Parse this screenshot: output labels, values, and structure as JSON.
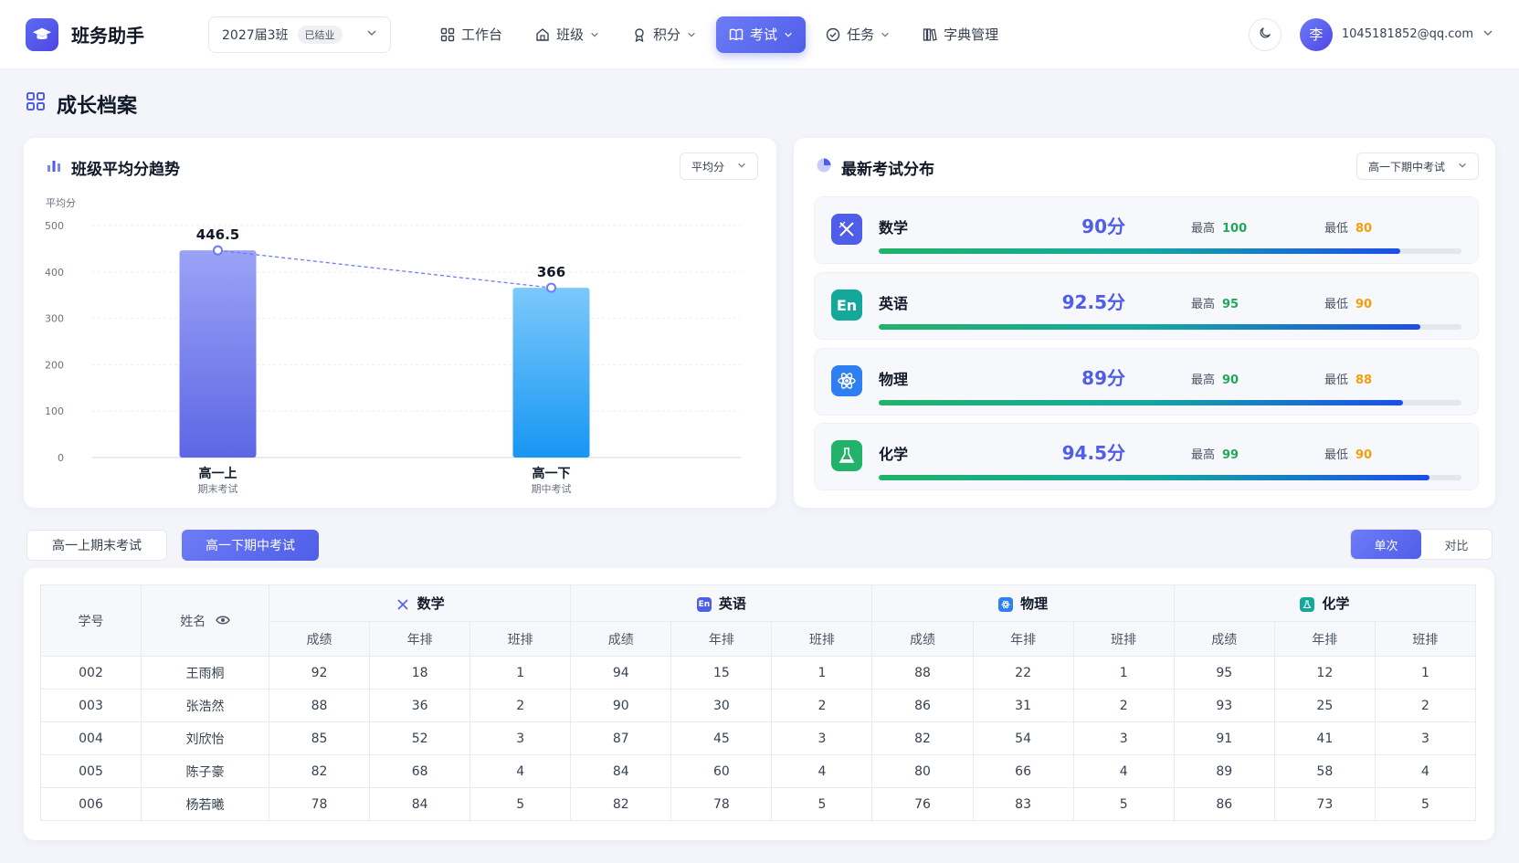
{
  "app": {
    "name": "班务助手"
  },
  "class_select": {
    "value": "2027届3班",
    "badge": "已结业"
  },
  "nav": [
    {
      "label": "工作台",
      "icon": "grid-icon",
      "dropdown": false,
      "active": false
    },
    {
      "label": "班级",
      "icon": "house-icon",
      "dropdown": true,
      "active": false
    },
    {
      "label": "积分",
      "icon": "award-icon",
      "dropdown": true,
      "active": false
    },
    {
      "label": "考试",
      "icon": "book-icon",
      "dropdown": true,
      "active": true
    },
    {
      "label": "任务",
      "icon": "check-circle-icon",
      "dropdown": true,
      "active": false
    },
    {
      "label": "字典管理",
      "icon": "books-icon",
      "dropdown": false,
      "active": false
    }
  ],
  "user": {
    "avatar": "李",
    "email": "1045181852@qq.com"
  },
  "page": {
    "title": "成长档案"
  },
  "trend_card": {
    "title": "班级平均分趋势",
    "select": "平均分"
  },
  "chart_data": {
    "type": "bar",
    "ylabel": "平均分",
    "ylim": [
      0,
      500
    ],
    "yticks": [
      0,
      100,
      200,
      300,
      400,
      500
    ],
    "categories": [
      "高一上",
      "高一下"
    ],
    "subcategories": [
      "期末考试",
      "期中考试"
    ],
    "values": [
      446.5,
      366
    ],
    "data_labels": [
      "446.5",
      "366"
    ],
    "colors": [
      "#7b86f1",
      "#2aa3f6"
    ],
    "trend_line": true,
    "grid": true
  },
  "dist_card": {
    "title": "最新考试分布",
    "select": "高一下期中考试",
    "max_label": "最高",
    "min_label": "最低",
    "subjects": [
      {
        "name": "数学",
        "icon": "math-icon",
        "icon_text": "",
        "color": "#4f5ee8",
        "avg": "90分",
        "max": "100",
        "min": "80",
        "progress": 0.895
      },
      {
        "name": "英语",
        "icon": "english-icon",
        "icon_text": "En",
        "color": "#14a89a",
        "avg": "92.5分",
        "max": "95",
        "min": "90",
        "progress": 0.93
      },
      {
        "name": "物理",
        "icon": "atom-icon",
        "icon_text": "",
        "color": "#2f7ff2",
        "avg": "89分",
        "max": "90",
        "min": "88",
        "progress": 0.9
      },
      {
        "name": "化学",
        "icon": "flask-icon",
        "icon_text": "",
        "color": "#22b26a",
        "avg": "94.5分",
        "max": "99",
        "min": "90",
        "progress": 0.945
      }
    ]
  },
  "exam_tabs": [
    {
      "label": "高一上期末考试",
      "active": false
    },
    {
      "label": "高一下期中考试",
      "active": true
    }
  ],
  "view_toggle": {
    "single": "单次",
    "compare": "对比"
  },
  "table": {
    "id_header": "学号",
    "name_header": "姓名",
    "subjects": [
      {
        "name": "数学",
        "color": "#4f5ee8",
        "icon_text": ""
      },
      {
        "name": "英语",
        "color": "#4f5ee8",
        "icon_text": "En"
      },
      {
        "name": "物理",
        "color": "#2f7ff2",
        "icon_text": ""
      },
      {
        "name": "化学",
        "color": "#14a89a",
        "icon_text": ""
      }
    ],
    "sub_headers": [
      "成绩",
      "年排",
      "班排"
    ],
    "rows": [
      {
        "id": "002",
        "name": "王雨桐",
        "scores": [
          "92",
          "18",
          "1",
          "94",
          "15",
          "1",
          "88",
          "22",
          "1",
          "95",
          "12",
          "1"
        ]
      },
      {
        "id": "003",
        "name": "张浩然",
        "scores": [
          "88",
          "36",
          "2",
          "90",
          "30",
          "2",
          "86",
          "31",
          "2",
          "93",
          "25",
          "2"
        ]
      },
      {
        "id": "004",
        "name": "刘欣怡",
        "scores": [
          "85",
          "52",
          "3",
          "87",
          "45",
          "3",
          "82",
          "54",
          "3",
          "91",
          "41",
          "3"
        ]
      },
      {
        "id": "005",
        "name": "陈子豪",
        "scores": [
          "82",
          "68",
          "4",
          "84",
          "60",
          "4",
          "80",
          "66",
          "4",
          "89",
          "58",
          "4"
        ]
      },
      {
        "id": "006",
        "name": "杨若曦",
        "scores": [
          "78",
          "84",
          "5",
          "82",
          "78",
          "5",
          "76",
          "83",
          "5",
          "86",
          "73",
          "5"
        ]
      }
    ]
  }
}
